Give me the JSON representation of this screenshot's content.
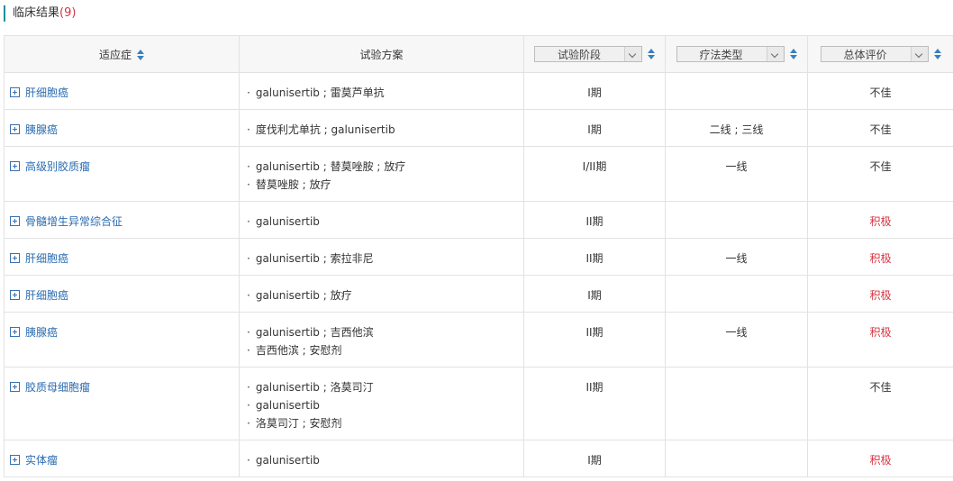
{
  "section": {
    "title": "临床结果",
    "count": "(9)"
  },
  "headers": {
    "indication": "适应症",
    "plan": "试验方案",
    "phase": "试验阶段",
    "therapy_type": "疗法类型",
    "evaluation": "总体评价"
  },
  "rows": [
    {
      "indication": "肝细胞癌",
      "plans": [
        "galunisertib ; 雷莫芦单抗"
      ],
      "phase": "I期",
      "therapy": "",
      "eval": "不佳",
      "eval_status": "neg"
    },
    {
      "indication": "胰腺癌",
      "plans": [
        "度伐利尤单抗 ; galunisertib"
      ],
      "phase": "I期",
      "therapy": "二线 ; 三线",
      "eval": "不佳",
      "eval_status": "neg"
    },
    {
      "indication": "高级别胶质瘤",
      "plans": [
        "galunisertib ; 替莫唑胺 ; 放疗",
        "替莫唑胺 ; 放疗"
      ],
      "phase": "I/II期",
      "therapy": "一线",
      "eval": "不佳",
      "eval_status": "neg"
    },
    {
      "indication": "骨髓增生异常综合征",
      "plans": [
        "galunisertib"
      ],
      "phase": "II期",
      "therapy": "",
      "eval": "积极",
      "eval_status": "pos"
    },
    {
      "indication": "肝细胞癌",
      "plans": [
        "galunisertib ; 索拉非尼"
      ],
      "phase": "II期",
      "therapy": "一线",
      "eval": "积极",
      "eval_status": "pos"
    },
    {
      "indication": "肝细胞癌",
      "plans": [
        "galunisertib ; 放疗"
      ],
      "phase": "I期",
      "therapy": "",
      "eval": "积极",
      "eval_status": "pos"
    },
    {
      "indication": "胰腺癌",
      "plans": [
        "galunisertib ; 吉西他滨",
        "吉西他滨 ; 安慰剂"
      ],
      "phase": "II期",
      "therapy": "一线",
      "eval": "积极",
      "eval_status": "pos"
    },
    {
      "indication": "胶质母细胞瘤",
      "plans": [
        "galunisertib ; 洛莫司汀",
        "galunisertib",
        "洛莫司汀 ; 安慰剂"
      ],
      "phase": "II期",
      "therapy": "",
      "eval": "不佳",
      "eval_status": "neg"
    },
    {
      "indication": "实体瘤",
      "plans": [
        "galunisertib"
      ],
      "phase": "I期",
      "therapy": "",
      "eval": "积极",
      "eval_status": "pos"
    }
  ],
  "colors": {
    "accent": "#1e8e9e",
    "link": "#2b6cb0",
    "positive": "#d9333f",
    "header_bg": "#f7f7f7"
  }
}
